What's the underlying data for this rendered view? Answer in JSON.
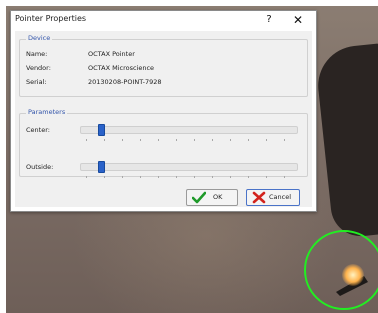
{
  "dialog": {
    "title": "Pointer Properties",
    "help_glyph": "?",
    "close_glyph": "✕"
  },
  "device": {
    "legend": "Device",
    "name_label": "Name:",
    "name_value": "OCTAX Pointer",
    "vendor_label": "Vendor:",
    "vendor_value": "OCTAX Microscience",
    "serial_label": "Serial:",
    "serial_value": "20130208-POINT-7928"
  },
  "parameters": {
    "legend": "Parameters",
    "center_label": "Center:",
    "center_value": 0.08,
    "outside_label": "Outside:",
    "outside_value": 0.08
  },
  "buttons": {
    "ok_label": "OK",
    "cancel_label": "Cancel"
  },
  "icons": {
    "ok": "green-checkmark-icon",
    "cancel": "red-x-icon"
  },
  "colors": {
    "ring": "#22ee22",
    "thumb": "#2a62c9",
    "ok_icon": "#1f9a2a",
    "cancel_icon": "#d2231d",
    "legend": "#3355aa"
  }
}
